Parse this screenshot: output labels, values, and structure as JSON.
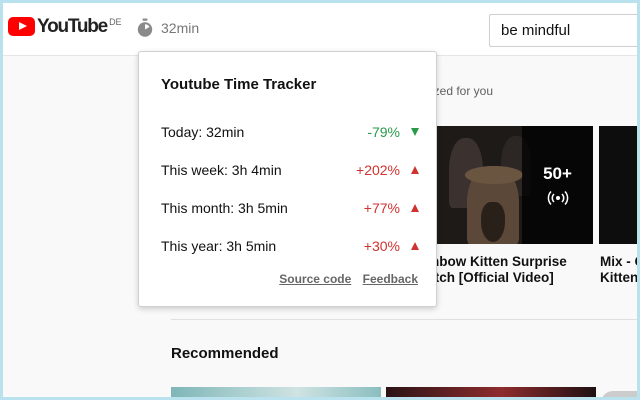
{
  "header": {
    "logo_text": "YouTube",
    "logo_country": "DE",
    "timer_text": "32min",
    "search_value": "be mindful"
  },
  "background": {
    "subtitle_fragment": "ized for you",
    "thumb_count": "50+",
    "video_titles": [
      [
        "nbow Kitten Surprise",
        "itch [Official Video]"
      ],
      [
        "Mix - C",
        "Kitten"
      ]
    ],
    "section_title": "Recommended"
  },
  "popup": {
    "title": "Youtube Time Tracker",
    "rows": [
      {
        "label": "Today: 32min",
        "change": "-79%",
        "trend": "down"
      },
      {
        "label": "This week: 3h 4min",
        "change": "+202%",
        "trend": "up"
      },
      {
        "label": "This month: 3h 5min",
        "change": "+77%",
        "trend": "up"
      },
      {
        "label": "This year: 3h 5min",
        "change": "+30%",
        "trend": "up"
      }
    ],
    "links": {
      "source_code": "Source code",
      "feedback": "Feedback"
    }
  },
  "colors": {
    "brand_red": "#ff0000",
    "positive_green": "#2a9a4a",
    "negative_red": "#d0322f",
    "frame_border": "#b9e1ee"
  }
}
